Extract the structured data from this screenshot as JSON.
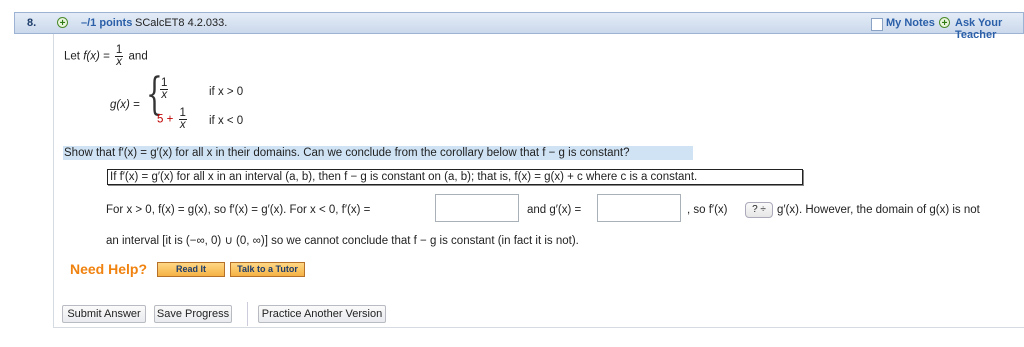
{
  "header": {
    "question_number": "8.",
    "points": "–/1 points",
    "source": "SCalcET8 4.2.033.",
    "my_notes": "My Notes",
    "ask_teacher": "Ask Your Teacher",
    "plus_glyph": "+"
  },
  "problem": {
    "let_prefix": "Let",
    "f_lhs": "f(x) =",
    "frac_one": "1",
    "frac_x": "x",
    "and_word": "and",
    "g_lhs": "g(x) =",
    "case1_cond": "if x > 0",
    "case2_prefix": "5 +",
    "case2_cond": "if x < 0",
    "show_that": "Show that  f′(x) = g′(x)  for all x in their domains. Can we conclude from the corollary below that  f − g  is constant?",
    "corollary": "If  f′(x) = g′(x)  for all x in an interval  (a, b),  then  f − g  is constant on  (a, b);  that is,  f(x) = g(x) + c  where c is a constant.",
    "line1_a": "For  x > 0,  f(x) = g(x),  so  f′(x) = g′(x).  For  x < 0,  f′(x) =",
    "line1_b": "and  g′(x) =",
    "line1_c": ",  so  f′(x)",
    "select_value": "? ÷",
    "line1_d": "g′(x).  However, the domain of  g(x)  is not",
    "line2": "an interval [it is  (−∞, 0) ∪ (0, ∞)]  so we cannot conclude that  f − g  is constant (in fact it is not)."
  },
  "help": {
    "title": "Need Help?",
    "read_it": "Read It",
    "talk_tutor": "Talk to a Tutor"
  },
  "actions": {
    "submit": "Submit Answer",
    "save": "Save Progress",
    "practice": "Practice Another Version"
  },
  "colors": {
    "link_blue": "#2b5fa8",
    "need_help_orange": "#f0820f",
    "highlight": "#cfe3f5",
    "red_five": "#c00000"
  }
}
